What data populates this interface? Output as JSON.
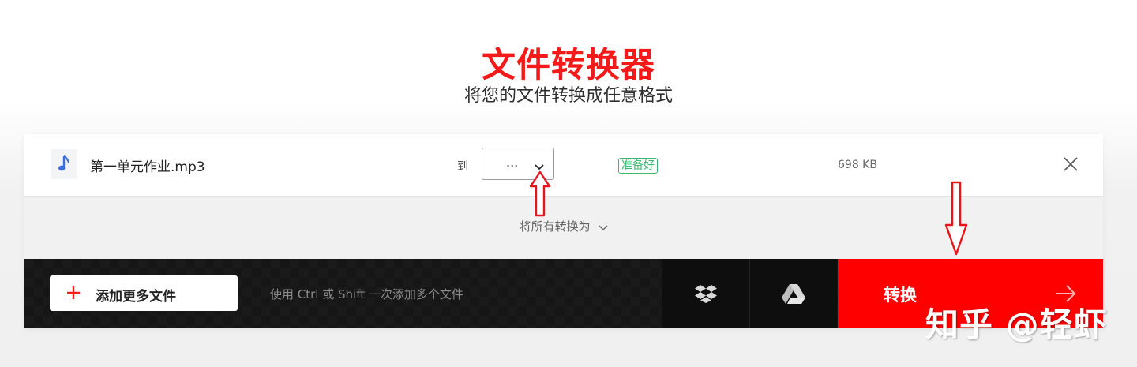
{
  "header": {
    "title": "文件转换器",
    "subtitle": "将您的文件转换成任意格式"
  },
  "file_row": {
    "icon": "music-note-icon",
    "file_name": "第一单元作业.mp3",
    "to_label": "到",
    "format_value": "...",
    "status": "准备好",
    "size": "698 KB"
  },
  "convert_all": {
    "label": "将所有转换为"
  },
  "bottom_bar": {
    "add_files_label": "添加更多文件",
    "hint": "使用 Ctrl 或 Shift 一次添加多个文件",
    "dropbox_icon": "dropbox-icon",
    "gdrive_icon": "google-drive-icon",
    "convert_label": "转换"
  },
  "watermark": "知乎 @轻虾",
  "colors": {
    "accent_red": "#ff0000",
    "title_red": "#f51a1a",
    "status_green": "#3bb56f",
    "bar_dark": "#1a1a1a",
    "note_blue": "#3b6fe0"
  }
}
